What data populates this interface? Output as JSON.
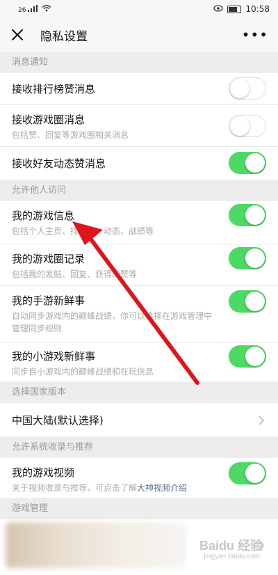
{
  "status_bar": {
    "signal": "26",
    "time": "10:58"
  },
  "header": {
    "title": "隐私设置"
  },
  "sections": {
    "notify": {
      "header": "消息通知",
      "items": [
        {
          "title": "接收排行榜赞消息",
          "toggle": "off"
        },
        {
          "title": "接收游戏圈消息",
          "subtitle": "包括赞、回复等游戏圈相关消息",
          "toggle": "off"
        },
        {
          "title": "接收好友动态赞消息",
          "toggle": "on"
        }
      ]
    },
    "access": {
      "header": "允许他人访问",
      "items": [
        {
          "title": "我的游戏信息",
          "subtitle": "包括个人主页、排行榜、动态、战绩等",
          "toggle": "on"
        },
        {
          "title": "我的游戏圈记录",
          "subtitle": "包括我的发贴、回复、获得的赞等",
          "toggle": "on"
        },
        {
          "title": "我的手游新鲜事",
          "subtitle": "自动同步游戏内的巅峰战绩，你可以选择在游戏管理中管理同步规则",
          "toggle": "on"
        },
        {
          "title": "我的小游戏新鲜事",
          "subtitle": "同步自小游戏内的巅峰战绩和在玩信息",
          "toggle": "on"
        }
      ]
    },
    "country": {
      "header": "选择国家版本",
      "item": {
        "title": "中国大陆(默认选择)"
      }
    },
    "recommend": {
      "header": "允许系统收录与推荐",
      "item": {
        "title": "我的游戏视频",
        "subtitle_prefix": "关于视频收录与推荐，可点击了解",
        "subtitle_link": "大神视频介绍",
        "toggle": "on"
      }
    },
    "manage": {
      "header": "游戏管理"
    }
  },
  "watermark": {
    "text": "Baidu 经验",
    "sub": "jingyan.baidu.com"
  },
  "colors": {
    "toggle_on": "#4cd964",
    "arrow": "#e0141b",
    "link": "#576b95"
  }
}
